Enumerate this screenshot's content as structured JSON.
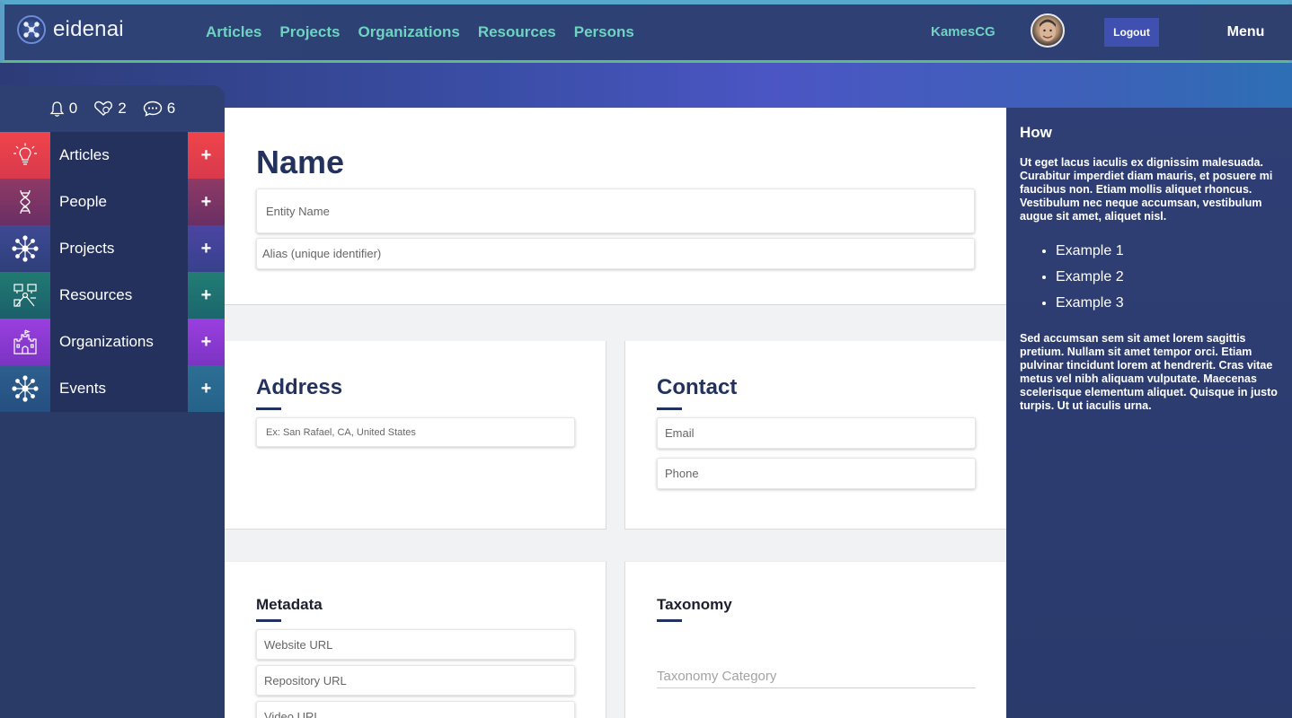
{
  "app": {
    "logo_text": "eidenai"
  },
  "nav": [
    "Articles",
    "Projects",
    "Organizations",
    "Resources",
    "Persons"
  ],
  "user": {
    "name": "KamesCG",
    "logout_label": "Logout",
    "menu_label": "Menu"
  },
  "counts": {
    "notifications": "0",
    "favorites": "2",
    "messages": "6"
  },
  "sidebar": {
    "items": [
      {
        "label": "Articles",
        "icon": "lightbulb-icon",
        "icon_color": "#e8414a",
        "add_color": "#e8414a"
      },
      {
        "label": "People",
        "icon": "dna-icon",
        "icon_color": "#7a3567",
        "add_color": "#7a3567"
      },
      {
        "label": "Projects",
        "icon": "network-icon",
        "icon_color": "#3c4a8c",
        "add_color": "#45459a"
      },
      {
        "label": "Resources",
        "icon": "tools-icon",
        "icon_color": "#1f6f6f",
        "add_color": "#1f7272"
      },
      {
        "label": "Organizations",
        "icon": "castle-icon",
        "icon_color": "#8a3ad0",
        "add_color": "#8a3ad0"
      },
      {
        "label": "Events",
        "icon": "network-icon",
        "icon_color": "#2c5a8a",
        "add_color": "#2c6d92"
      }
    ],
    "add_symbol": "+"
  },
  "form": {
    "name": {
      "heading": "Name",
      "entity_placeholder": "Entity Name",
      "alias_placeholder": "Alias (unique identifier)"
    },
    "address": {
      "heading": "Address",
      "placeholder": "Ex: San Rafael, CA, United States"
    },
    "contact": {
      "heading": "Contact",
      "email_placeholder": "Email",
      "phone_placeholder": "Phone"
    },
    "metadata": {
      "heading": "Metadata",
      "website_placeholder": "Website URL",
      "repository_placeholder": "Repository URL",
      "video_placeholder": "Video URL"
    },
    "taxonomy": {
      "heading": "Taxonomy",
      "category_placeholder": "Taxonomy Category"
    }
  },
  "help": {
    "title": "How",
    "paragraph1": "Ut eget lacus iaculis ex dignissim malesuada. Curabitur imperdiet diam mauris, et posuere mi faucibus non. Etiam mollis aliquet rhoncus. Vestibulum nec neque accumsan, vestibulum augue sit amet, aliquet nisl.",
    "examples": [
      "Example 1",
      "Example 2",
      "Example 3"
    ],
    "paragraph2": "Sed accumsan sem sit amet lorem sagittis pretium. Nullam sit amet tempor orci. Etiam pulvinar tincidunt lorem at hendrerit. Cras vitae metus vel nibh aliquam vulputate. Maecenas scelerisque elementum aliquet. Quisque in justo turpis. Ut ut iaculis urna."
  },
  "colors": {
    "nav_link": "#6fd3c2",
    "heading": "#23325c",
    "logout_bg": "#3f50b0"
  }
}
